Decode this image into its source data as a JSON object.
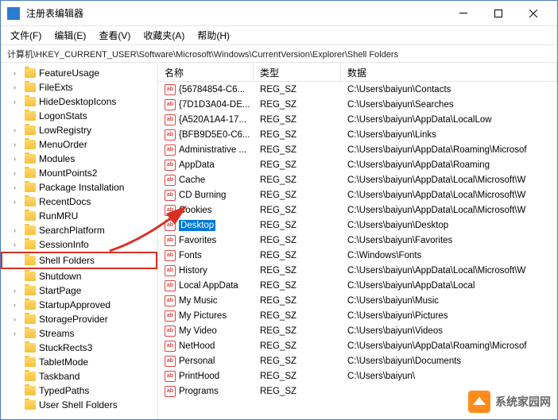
{
  "window": {
    "title": "注册表编辑器"
  },
  "menu": {
    "file": "文件(F)",
    "edit": "编辑(E)",
    "view": "查看(V)",
    "favorites": "收藏夹(A)",
    "help": "帮助(H)"
  },
  "address": "计算机\\HKEY_CURRENT_USER\\Software\\Microsoft\\Windows\\CurrentVersion\\Explorer\\Shell Folders",
  "tree": [
    {
      "label": "FeatureUsage",
      "expandable": true
    },
    {
      "label": "FileExts",
      "expandable": true
    },
    {
      "label": "HideDesktopIcons",
      "expandable": true
    },
    {
      "label": "LogonStats",
      "expandable": false
    },
    {
      "label": "LowRegistry",
      "expandable": true
    },
    {
      "label": "MenuOrder",
      "expandable": true
    },
    {
      "label": "Modules",
      "expandable": true
    },
    {
      "label": "MountPoints2",
      "expandable": true
    },
    {
      "label": "Package Installation",
      "expandable": true
    },
    {
      "label": "RecentDocs",
      "expandable": true
    },
    {
      "label": "RunMRU",
      "expandable": false
    },
    {
      "label": "SearchPlatform",
      "expandable": true
    },
    {
      "label": "SessionInfo",
      "expandable": true
    },
    {
      "label": "Shell Folders",
      "expandable": false,
      "highlighted": true
    },
    {
      "label": "Shutdown",
      "expandable": false
    },
    {
      "label": "StartPage",
      "expandable": true
    },
    {
      "label": "StartupApproved",
      "expandable": true
    },
    {
      "label": "StorageProvider",
      "expandable": true
    },
    {
      "label": "Streams",
      "expandable": true
    },
    {
      "label": "StuckRects3",
      "expandable": false
    },
    {
      "label": "TabletMode",
      "expandable": false
    },
    {
      "label": "Taskband",
      "expandable": false
    },
    {
      "label": "TypedPaths",
      "expandable": false
    },
    {
      "label": "User Shell Folders",
      "expandable": false
    }
  ],
  "columns": {
    "name": "名称",
    "type": "类型",
    "data": "数据"
  },
  "values": [
    {
      "name": "{56784854-C6...",
      "type": "REG_SZ",
      "data": "C:\\Users\\baiyun\\Contacts"
    },
    {
      "name": "{7D1D3A04-DE...",
      "type": "REG_SZ",
      "data": "C:\\Users\\baiyun\\Searches"
    },
    {
      "name": "{A520A1A4-17...",
      "type": "REG_SZ",
      "data": "C:\\Users\\baiyun\\AppData\\LocalLow"
    },
    {
      "name": "{BFB9D5E0-C6...",
      "type": "REG_SZ",
      "data": "C:\\Users\\baiyun\\Links"
    },
    {
      "name": "Administrative ...",
      "type": "REG_SZ",
      "data": "C:\\Users\\baiyun\\AppData\\Roaming\\Microsof"
    },
    {
      "name": "AppData",
      "type": "REG_SZ",
      "data": "C:\\Users\\baiyun\\AppData\\Roaming"
    },
    {
      "name": "Cache",
      "type": "REG_SZ",
      "data": "C:\\Users\\baiyun\\AppData\\Local\\Microsoft\\W"
    },
    {
      "name": "CD Burning",
      "type": "REG_SZ",
      "data": "C:\\Users\\baiyun\\AppData\\Local\\Microsoft\\W"
    },
    {
      "name": "Cookies",
      "type": "REG_SZ",
      "data": "C:\\Users\\baiyun\\AppData\\Local\\Microsoft\\W"
    },
    {
      "name": "Desktop",
      "type": "REG_SZ",
      "data": "C:\\Users\\baiyun\\Desktop",
      "selected": true
    },
    {
      "name": "Favorites",
      "type": "REG_SZ",
      "data": "C:\\Users\\baiyun\\Favorites"
    },
    {
      "name": "Fonts",
      "type": "REG_SZ",
      "data": "C:\\Windows\\Fonts"
    },
    {
      "name": "History",
      "type": "REG_SZ",
      "data": "C:\\Users\\baiyun\\AppData\\Local\\Microsoft\\W"
    },
    {
      "name": "Local AppData",
      "type": "REG_SZ",
      "data": "C:\\Users\\baiyun\\AppData\\Local"
    },
    {
      "name": "My Music",
      "type": "REG_SZ",
      "data": "C:\\Users\\baiyun\\Music"
    },
    {
      "name": "My Pictures",
      "type": "REG_SZ",
      "data": "C:\\Users\\baiyun\\Pictures"
    },
    {
      "name": "My Video",
      "type": "REG_SZ",
      "data": "C:\\Users\\baiyun\\Videos"
    },
    {
      "name": "NetHood",
      "type": "REG_SZ",
      "data": "C:\\Users\\baiyun\\AppData\\Roaming\\Microsof"
    },
    {
      "name": "Personal",
      "type": "REG_SZ",
      "data": "C:\\Users\\baiyun\\Documents"
    },
    {
      "name": "PrintHood",
      "type": "REG_SZ",
      "data": "C:\\Users\\baiyun\\"
    },
    {
      "name": "Programs",
      "type": "REG_SZ",
      "data": ""
    }
  ],
  "watermark": "系统家园网"
}
